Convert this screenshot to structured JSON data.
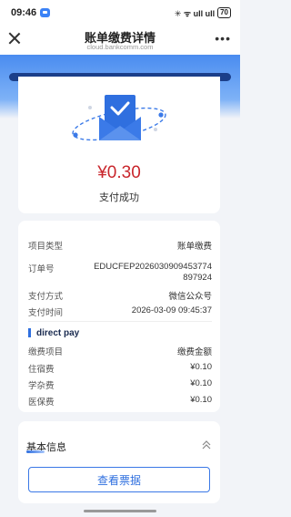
{
  "status_bar": {
    "time": "09:46",
    "right_indicators": "✳ ᯤ ull ull",
    "battery": "70"
  },
  "nav": {
    "title": "账单缴费详情",
    "subtitle": "cloud.bankcomm.com",
    "more": "•••"
  },
  "receipt": {
    "amount": "¥0.30",
    "status": "支付成功"
  },
  "details": {
    "project_type": {
      "label": "项目类型",
      "value": "账单缴费"
    },
    "order_no": {
      "label": "订单号",
      "value": "EDUCFEP2026030909453774897924"
    },
    "pay_method": {
      "label": "支付方式",
      "value": "微信公众号"
    },
    "pay_time": {
      "label": "支付时间",
      "value": "2026-03-09 09:45:37"
    }
  },
  "fee_section": {
    "title": "direct pay",
    "header_item": "缴费项目",
    "header_amount": "缴费金额",
    "items": [
      {
        "name": "住宿费",
        "amount": "¥0.10"
      },
      {
        "name": "学杂费",
        "amount": "¥0.10"
      },
      {
        "name": "医保费",
        "amount": "¥0.10"
      }
    ]
  },
  "basic_info": {
    "title": "基本信息",
    "button_label": "查看票据"
  },
  "colors": {
    "accent": "#2f6fdf",
    "amount": "#c9262c",
    "header_gradient_top": "#4a8cf0"
  },
  "icons": [
    "close-icon",
    "more-icon",
    "envelope-check-icon",
    "collapse-up-icon"
  ]
}
